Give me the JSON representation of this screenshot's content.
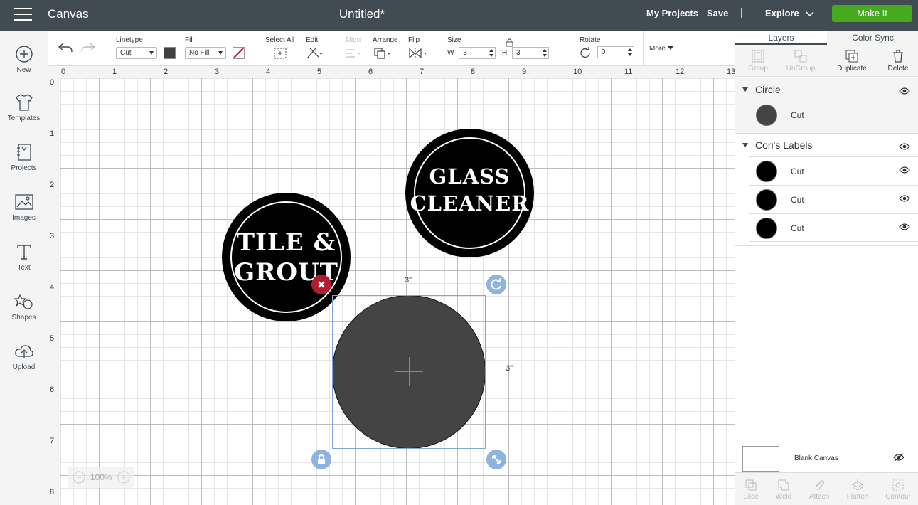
{
  "topbar": {
    "app_title": "Canvas",
    "doc_title": "Untitled*",
    "my_projects": "My Projects",
    "save": "Save",
    "separator": "|",
    "explore": "Explore",
    "make_it": "Make It",
    "make_it_color": "#47a91f",
    "bar_color": "#414b52"
  },
  "toolbar": {
    "linetype_label": "Linetype",
    "linetype_value": "Cut",
    "fill_label": "Fill",
    "fill_value": "No Fill",
    "select_all_label": "Select All",
    "edit_label": "Edit",
    "align_label": "Align",
    "arrange_label": "Arrange",
    "flip_label": "Flip",
    "size_label": "Size",
    "w_label": "W",
    "w_value": "3",
    "h_label": "H",
    "h_value": "3",
    "rotate_label": "Rotate",
    "rotate_value": "0",
    "more_label": "More"
  },
  "sidebar": {
    "items": [
      {
        "label": "New",
        "icon": "plus-circle-icon"
      },
      {
        "label": "Templates",
        "icon": "tshirt-icon"
      },
      {
        "label": "Projects",
        "icon": "notebook-icon"
      },
      {
        "label": "Images",
        "icon": "image-icon"
      },
      {
        "label": "Text",
        "icon": "text-icon"
      },
      {
        "label": "Shapes",
        "icon": "shapes-icon"
      },
      {
        "label": "Upload",
        "icon": "cloud-upload-icon"
      }
    ]
  },
  "canvas": {
    "ruler_top": [
      "0",
      "1",
      "2",
      "3",
      "4",
      "5",
      "6",
      "7",
      "8",
      "9",
      "10",
      "11",
      "12",
      "13"
    ],
    "ruler_left": [
      "0",
      "1",
      "2",
      "3",
      "4",
      "5",
      "6",
      "7",
      "8"
    ],
    "labels": [
      {
        "line1": "TILE &",
        "line2": "GROUT"
      },
      {
        "line1": "GLASS",
        "line2": "CLEANER"
      }
    ],
    "selection_width": "3\"",
    "selection_height": "3\"",
    "zoom_value": "100%",
    "shape_color": "#444444",
    "selection_color": "#7fa7d6",
    "delete_handle_color": "#b31b2e"
  },
  "panel": {
    "tab_layers": "Layers",
    "tab_color_sync": "Color Sync",
    "actions": {
      "group": "Group",
      "ungroup": "UnGroup",
      "duplicate": "Duplicate",
      "delete": "Delete"
    },
    "groups": [
      {
        "name": "Circle",
        "layers": [
          {
            "name": "Cut",
            "thumb": "circle"
          }
        ]
      },
      {
        "name": "Cori's Labels",
        "layers": [
          {
            "name": "Cut",
            "thumb": "glass-cleaner-label"
          },
          {
            "name": "Cut",
            "thumb": "tile-grout-label"
          },
          {
            "name": "Cut",
            "thumb": "cleaning-label"
          }
        ]
      }
    ],
    "blank_canvas": "Blank Canvas",
    "bottom_actions": {
      "slice": "Slice",
      "weld": "Weld",
      "attach": "Attach",
      "flatten": "Flatten",
      "contour": "Contour"
    }
  }
}
